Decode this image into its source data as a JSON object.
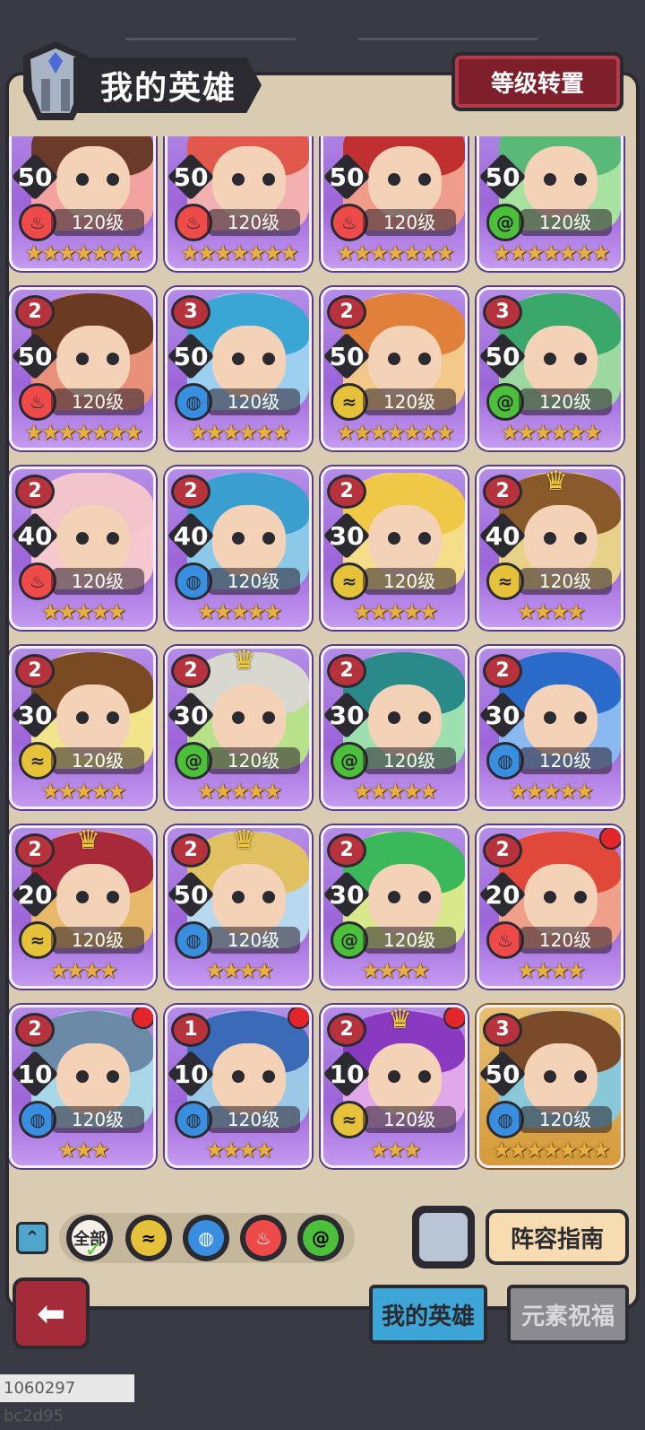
{
  "header": {
    "title": "我的英雄",
    "reset_button": "等级转置"
  },
  "colors": {
    "fire": "#ef4a4a",
    "water": "#3a8ee0",
    "wind": "#4cc03a",
    "earth": "#e6c23a",
    "card_purple": "#9c64d8",
    "card_gold": "#d59a3a"
  },
  "heroes": [
    {
      "rank": "",
      "stat": "50",
      "level": "120级",
      "element": "fire",
      "stars": "★★★★★★★",
      "hair": "#6a3a2a",
      "bg": "#f2a3a0"
    },
    {
      "rank": "",
      "stat": "50",
      "level": "120级",
      "element": "fire",
      "stars": "★★★★★★★",
      "hair": "#e2584c",
      "bg": "#f2b0b0"
    },
    {
      "rank": "",
      "stat": "50",
      "level": "120级",
      "element": "fire",
      "stars": "★★★★★★★",
      "hair": "#c03030",
      "bg": "#ef9d8a"
    },
    {
      "rank": "",
      "stat": "50",
      "level": "120级",
      "element": "wind",
      "stars": "★★★★★★★",
      "hair": "#5ab878",
      "bg": "#a8e2a0"
    },
    {
      "rank": "2",
      "stat": "50",
      "level": "120级",
      "element": "fire",
      "stars": "★★★★★★★",
      "hair": "#6a3a22",
      "bg": "#e8907a"
    },
    {
      "rank": "3",
      "stat": "50",
      "level": "120级",
      "element": "water",
      "stars": "★★★★★★",
      "hair": "#3aa6d6",
      "bg": "#9ccff0"
    },
    {
      "rank": "2",
      "stat": "50",
      "level": "120级",
      "element": "earth",
      "stars": "★★★★★★★",
      "hair": "#e0803a",
      "bg": "#f2c98a"
    },
    {
      "rank": "3",
      "stat": "50",
      "level": "120级",
      "element": "wind",
      "stars": "★★★★★★",
      "hair": "#3aa86a",
      "bg": "#9cd8a0"
    },
    {
      "rank": "2",
      "stat": "40",
      "level": "120级",
      "element": "fire",
      "stars": "★★★★★",
      "hair": "#f2c4cc",
      "bg": "#f6c8d0"
    },
    {
      "rank": "2",
      "stat": "40",
      "level": "120级",
      "element": "water",
      "stars": "★★★★★",
      "hair": "#3a9ed0",
      "bg": "#8cc8e8"
    },
    {
      "rank": "2",
      "stat": "30",
      "level": "120级",
      "element": "earth",
      "stars": "★★★★★",
      "hair": "#f0c848",
      "bg": "#f6dd8a"
    },
    {
      "rank": "2",
      "stat": "40",
      "level": "120级",
      "element": "earth",
      "stars": "★★★★",
      "hair": "#8a5a2a",
      "bg": "#e8d28a",
      "crown": "♛"
    },
    {
      "rank": "2",
      "stat": "30",
      "level": "120级",
      "element": "earth",
      "stars": "★★★★★",
      "hair": "#7a4a22",
      "bg": "#f2e48a"
    },
    {
      "rank": "2",
      "stat": "30",
      "level": "120级",
      "element": "wind",
      "stars": "★★★★★",
      "hair": "#d8d8d0",
      "bg": "#b8e28a",
      "crown": "♛"
    },
    {
      "rank": "2",
      "stat": "30",
      "level": "120级",
      "element": "wind",
      "stars": "★★★★★",
      "hair": "#2a8a8a",
      "bg": "#9ce0b0"
    },
    {
      "rank": "2",
      "stat": "30",
      "level": "120级",
      "element": "water",
      "stars": "★★★★★",
      "hair": "#2a6ac8",
      "bg": "#8ab8f0"
    },
    {
      "rank": "2",
      "stat": "20",
      "level": "120级",
      "element": "earth",
      "stars": "★★★★",
      "hair": "#a82a3a",
      "bg": "#e8b86a",
      "crown": "♛"
    },
    {
      "rank": "2",
      "stat": "50",
      "level": "120级",
      "element": "water",
      "stars": "★★★★",
      "hair": "#e0c060",
      "bg": "#b8d8f0",
      "crown": "♛"
    },
    {
      "rank": "2",
      "stat": "30",
      "level": "120级",
      "element": "wind",
      "stars": "★★★★",
      "hair": "#3ab85a",
      "bg": "#d8e88a"
    },
    {
      "rank": "2",
      "stat": "20",
      "level": "120级",
      "element": "fire",
      "stars": "★★★★",
      "hair": "#e0483a",
      "bg": "#f0a08a",
      "dot": true
    },
    {
      "rank": "2",
      "stat": "10",
      "level": "120级",
      "element": "water",
      "stars": "★★★",
      "hair": "#6a8aa8",
      "bg": "#a8d8e8",
      "dot": true
    },
    {
      "rank": "1",
      "stat": "10",
      "level": "120级",
      "element": "water",
      "stars": "★★★★",
      "hair": "#3a6ab8",
      "bg": "#9cc8e8",
      "dot": true
    },
    {
      "rank": "2",
      "stat": "10",
      "level": "120级",
      "element": "earth",
      "stars": "★★★",
      "hair": "#8a3ac0",
      "bg": "#e0a8e8",
      "crown": "♛",
      "dot": true
    },
    {
      "rank": "3",
      "stat": "50",
      "level": "120级",
      "element": "water",
      "stars": "★★★★★★★",
      "hair": "#7a4a2a",
      "bg": "#88c8d8",
      "gold": true
    }
  ],
  "filters": {
    "all_label": "全部",
    "element_icons": [
      "earth-icon",
      "water-icon",
      "fire-icon",
      "wind-icon"
    ]
  },
  "buttons": {
    "guide": "阵容指南"
  },
  "tabs": {
    "my_heroes": "我的英雄",
    "elemental_blessing": "元素祝福"
  },
  "footer": {
    "build_id": "1060297 bc2d95"
  }
}
